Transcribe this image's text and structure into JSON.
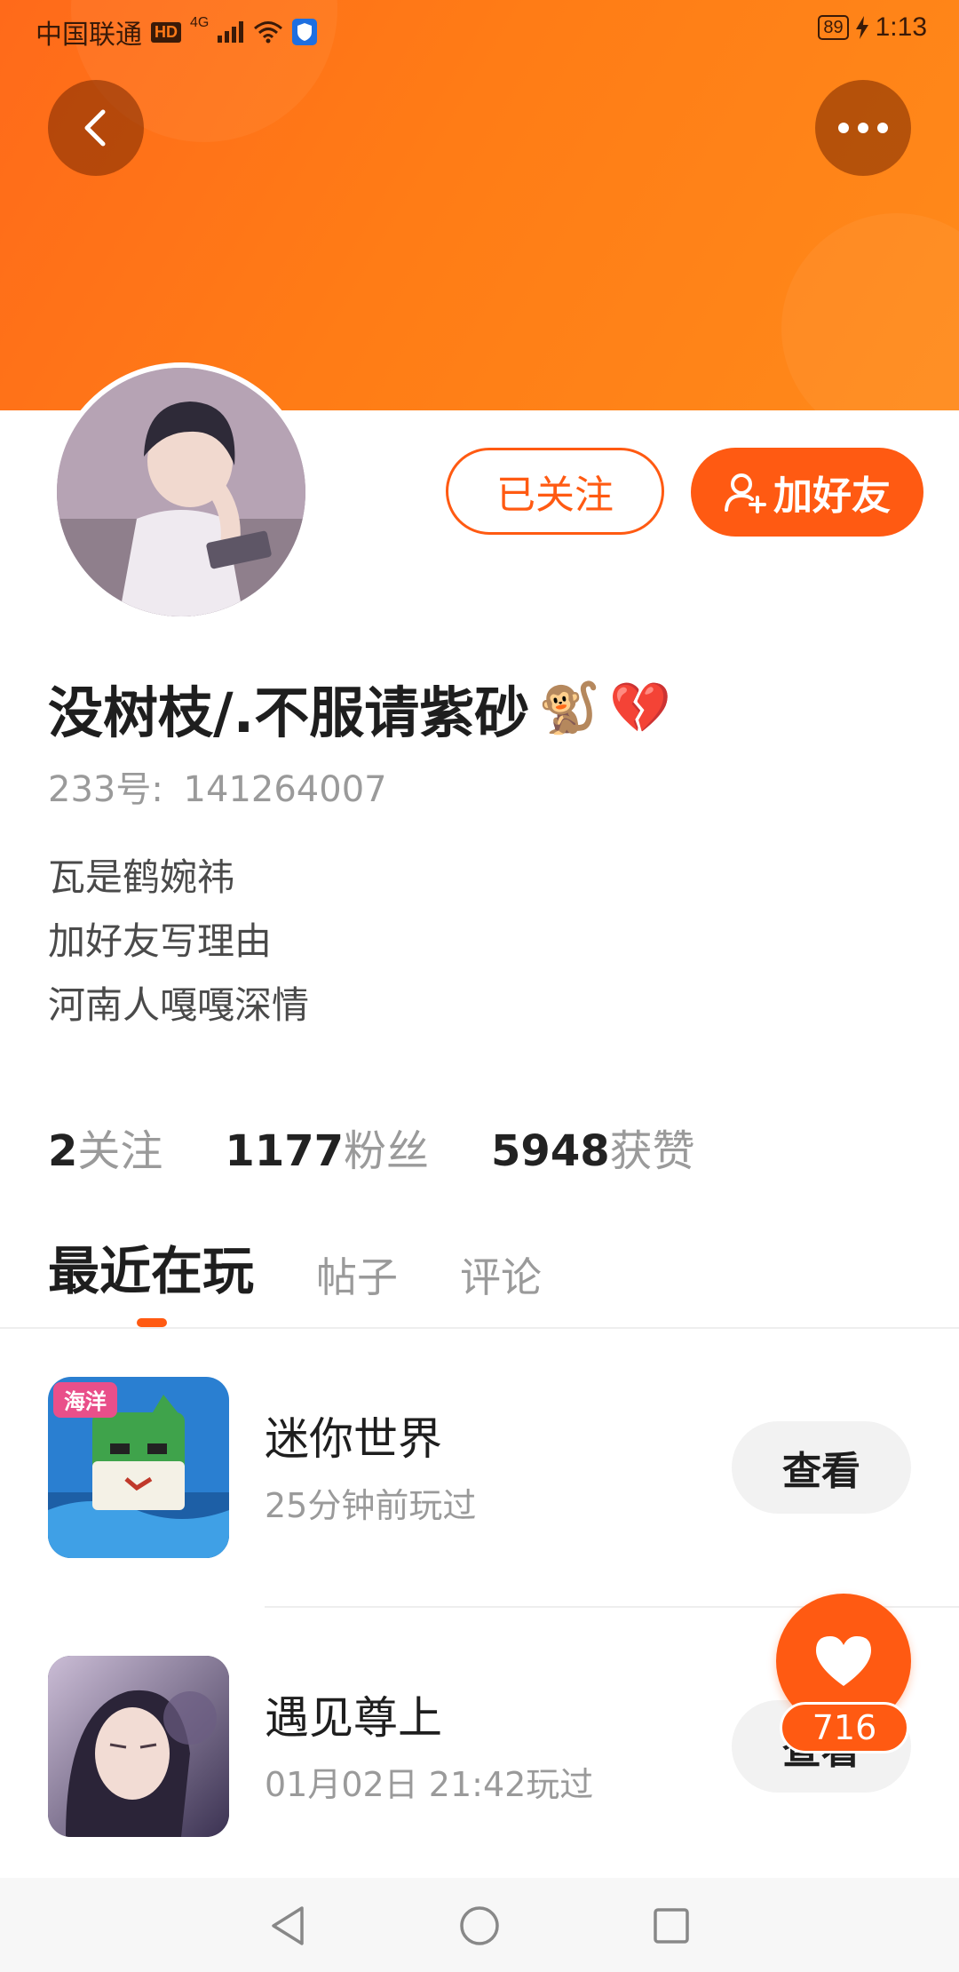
{
  "status_bar": {
    "carrier": "中国联通",
    "hd": "HD",
    "network": "4G",
    "battery": "89",
    "time": "1:13"
  },
  "profile": {
    "name": "没树枝/.不服请紫砂",
    "name_emojis": [
      "🐒",
      "💔"
    ],
    "uid_label": "233号:",
    "uid": "141264007",
    "bio": [
      "瓦是鹤婉祎",
      "加好友写理由",
      "河南人嘎嘎深情"
    ],
    "follow_button": "已关注",
    "add_friend_button": "加好友"
  },
  "stats": [
    {
      "value": "2",
      "label": "关注"
    },
    {
      "value": "1177",
      "label": "粉丝"
    },
    {
      "value": "5948",
      "label": "获赞"
    }
  ],
  "tabs": [
    {
      "label": "最近在玩",
      "active": true
    },
    {
      "label": "帖子",
      "active": false
    },
    {
      "label": "评论",
      "active": false
    }
  ],
  "games": [
    {
      "name": "迷你世界",
      "time": "25分钟前玩过",
      "button": "查看",
      "icon_text": "海洋"
    },
    {
      "name": "遇见尊上",
      "time": "01月02日 21:42玩过",
      "button": "查看"
    }
  ],
  "like": {
    "count": "716"
  },
  "colors": {
    "accent": "#ff5a12",
    "banner": "#ff7a18"
  }
}
